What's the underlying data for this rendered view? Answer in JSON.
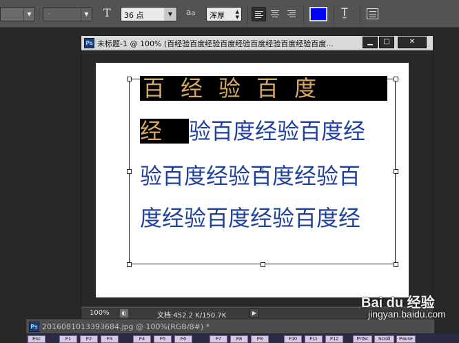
{
  "options_bar": {
    "font_family_value": "",
    "font_style_value": "-",
    "font_size_value": "36 点",
    "antialias_value": "浑厚",
    "text_color": "#0000ff"
  },
  "document": {
    "title": "未标题-1 @ 100% (百经验百度经验百度经验百度经验百度经验百度...",
    "text_lines": [
      {
        "selected": "百经验百度",
        "rest": ""
      },
      {
        "selected": "经",
        "rest": "验百度经验百度经"
      },
      {
        "selected": "",
        "rest": "验百度经验百度经验百"
      },
      {
        "selected": "",
        "rest": "度经验百度经验百度经"
      }
    ],
    "status": {
      "zoom": "100%",
      "doc_info": "文档:452.2 K/150.7K"
    }
  },
  "second_doc": {
    "title": "2016081013393684.jpg @ 100%(RGB/8#) *"
  },
  "keyboard": {
    "keys": [
      "Esc",
      "F1",
      "F2",
      "F3",
      "F4",
      "F5",
      "F6",
      "F7",
      "F8",
      "F9",
      "F10",
      "F11",
      "F12",
      "PrtSc",
      "Scroll",
      "Pause"
    ]
  },
  "watermark": {
    "logo_text": "Bai du 经验",
    "url": "jingyan.baidu.com"
  },
  "icons": {
    "text_orientation": "text-orientation-icon",
    "antialias": "antialias-icon",
    "warp": "warp-text-icon",
    "panels": "character-panel-icon"
  }
}
